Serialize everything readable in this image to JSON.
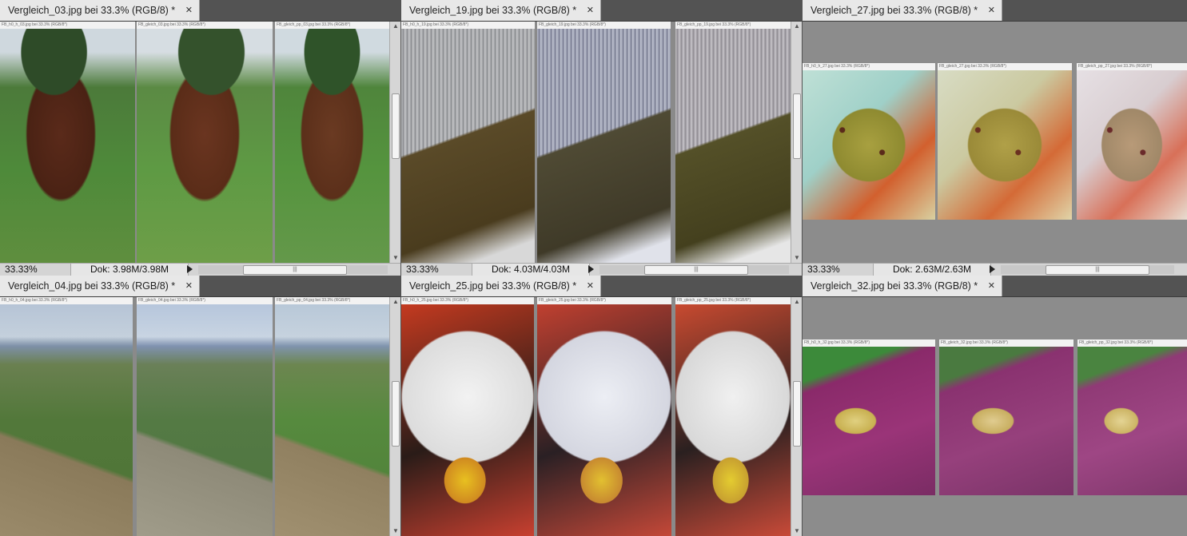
{
  "windows": [
    {
      "tab": "Vergleich_03.jpg bei 33.3% (RGB/8) *",
      "zoom": "33.33%",
      "doc": "Dok: 3.98M/3.98M",
      "thumbs": [
        "FB_h0_h_03.jpg bei 33.3% (RGB/8*)",
        "FB_gleich_03.jpg bei 33.3% (RGB/8*)",
        "FB_gleich_pp_03.jpg bei 33.3% (RGB/8*)"
      ]
    },
    {
      "tab": "Vergleich_19.jpg bei 33.3% (RGB/8) *",
      "zoom": "33.33%",
      "doc": "Dok: 4.03M/4.03M",
      "thumbs": [
        "FB_h0_h_19.jpg bei 33.3% (RGB/8*)",
        "FB_gleich_19.jpg bei 33.3% (RGB/8*)",
        "FB_gleich_pp_19.jpg bei 33.3% (RGB/8*)"
      ]
    },
    {
      "tab": "Vergleich_27.jpg bei 33.3% (RGB/8) *",
      "zoom": "33.33%",
      "doc": "Dok: 2.63M/2.63M",
      "thumbs": [
        "FB_h0_h_27.jpg bei 33.3% (RGB/8*)",
        "FB_gleich_27.jpg bei 33.3% (RGB/8*)",
        "FB_gleich_pp_27.jpg bei 33.3% (RGB/8*)"
      ]
    },
    {
      "tab": "Vergleich_04.jpg bei 33.3% (RGB/8) *",
      "thumbs": [
        "FB_h0_h_04.jpg bei 33.3% (RGB/8*)",
        "FB_gleich_04.jpg bei 33.3% (RGB/8*)",
        "FB_gleich_pp_04.jpg bei 33.3% (RGB/8*)"
      ]
    },
    {
      "tab": "Vergleich_25.jpg bei 33.3% (RGB/8) *",
      "thumbs": [
        "FB_h0_h_25.jpg bei 33.3% (RGB/8*)",
        "FB_gleich_25.jpg bei 33.3% (RGB/8*)",
        "FB_gleich_pp_25.jpg bei 33.3% (RGB/8*)"
      ]
    },
    {
      "tab": "Vergleich_32.jpg bei 33.3% (RGB/8) *",
      "thumbs": [
        "FB_h0_h_32.jpg bei 33.3% (RGB/8*)",
        "FB_gleich_32.jpg bei 33.3% (RGB/8*)",
        "FB_gleich_pp_32.jpg bei 33.3% (RGB/8*)"
      ]
    }
  ],
  "icons": {
    "close": "close-icon",
    "play": "play-icon",
    "grip": "scroll-grip-icon"
  },
  "colors": {
    "workspace": "#525252",
    "tab_active": "#e8e8e8",
    "status_bar": "#d4d4d4"
  }
}
